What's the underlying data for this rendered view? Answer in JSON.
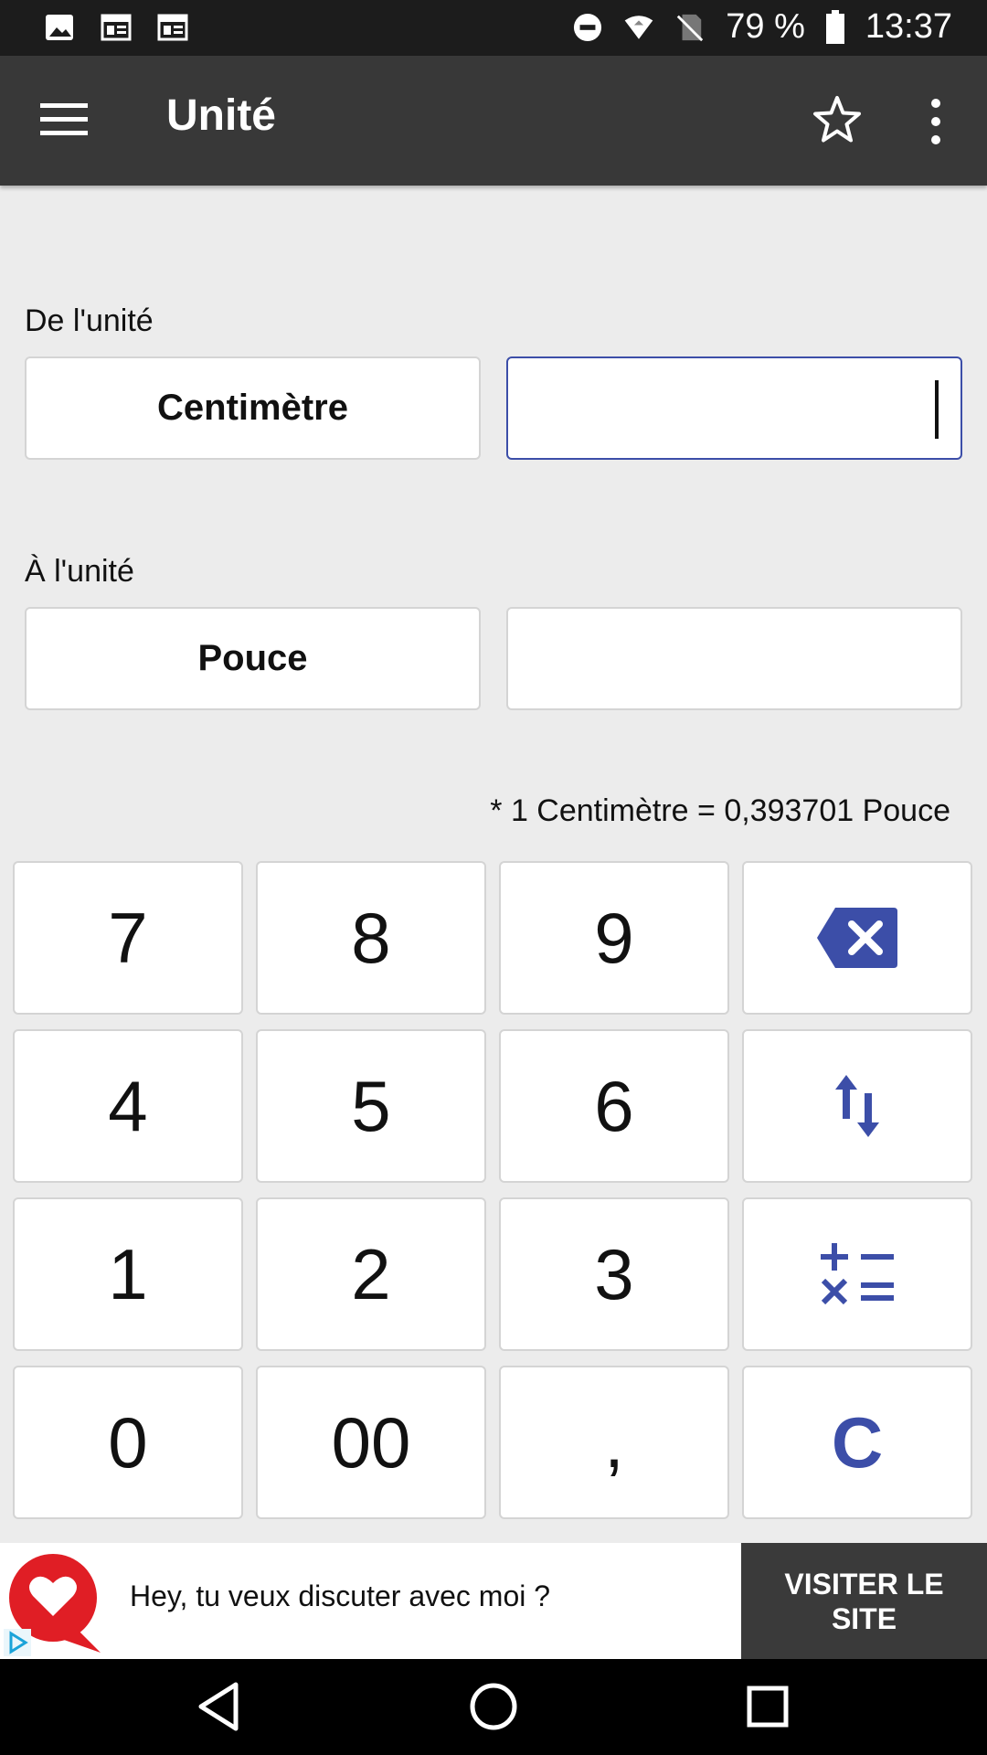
{
  "status_bar": {
    "battery": "79 %",
    "time": "13:37"
  },
  "app_bar": {
    "title": "Unité"
  },
  "from_unit": {
    "label": "De l'unité",
    "unit": "Centimètre",
    "value": ""
  },
  "to_unit": {
    "label": "À l'unité",
    "unit": "Pouce",
    "value": ""
  },
  "conversion_note": "* 1 Centimètre = 0,393701 Pouce",
  "keypad": {
    "k7": "7",
    "k8": "8",
    "k9": "9",
    "k4": "4",
    "k5": "5",
    "k6": "6",
    "k1": "1",
    "k2": "2",
    "k3": "3",
    "k0": "0",
    "k00": "00",
    "comma": ",",
    "clear": "C"
  },
  "ad": {
    "text": "Hey, tu veux discuter avec moi ?",
    "cta": "VISITER LE SITE"
  },
  "colors": {
    "accent": "#3c4ea8",
    "app_bar": "#383838",
    "status_bar": "#1c1c1c",
    "background": "#ececec"
  }
}
